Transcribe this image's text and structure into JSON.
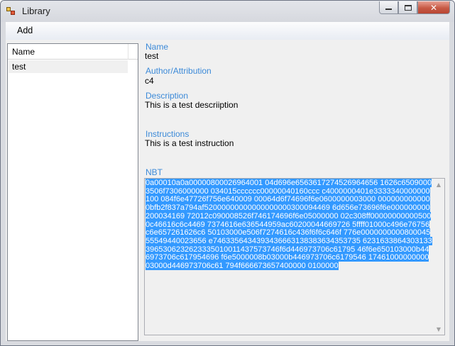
{
  "window": {
    "title": "Library",
    "caption_buttons": {
      "minimize": "▭",
      "maximize": "□",
      "close": "✕"
    }
  },
  "menu": {
    "items": [
      "Add"
    ]
  },
  "list": {
    "column_header": "Name",
    "items": [
      {
        "name": "test",
        "selected": true
      }
    ]
  },
  "details": {
    "name_label": "Name",
    "name_value": "test",
    "author_label": "Author/Attribution",
    "author_value": "c4",
    "description_label": "Description",
    "description_value": "This is a test descriiption",
    "instructions_label": "Instructions",
    "instructions_value": "This is a test instruction",
    "nbt_label": "NBT",
    "nbt_value": "0a00010a0a00000800026964001 04d696e6563617274526964656 1626c65090003506f7306000000 034015cccccc00000040160ccc c4000000401e3333340000000100 084f6e47726f756e640009 00064d6f74696f6e0600000003000 0000000000000bfb2f837a794af52000000000000000000300094469 6d656e73696f6e000000000200034169 72012c090008526f746174696f6e05000000 02c308ff000000000005000c46616c6c4469 7374616e636544959ac60200044669726 5ffff01000c496e76756c6e657261626c6 50103000e506f7274616c436f6f6c646f 776e000000000080004555549440023656 e7463356434393436663138383634353735 62316338643031333965306232623335010011437573746f6d446973706c61795 46f6e650103000b446973706c617954696 f6e5000008b03000b446973706c6179546 1746100000000003000d446973706c61 794f666673657400000 0100000"
  },
  "colors": {
    "label_blue": "#3c8ad8",
    "selection_blue": "#3399ff",
    "panel_bg": "#f0f0f0",
    "close_red": "#c75a45"
  }
}
